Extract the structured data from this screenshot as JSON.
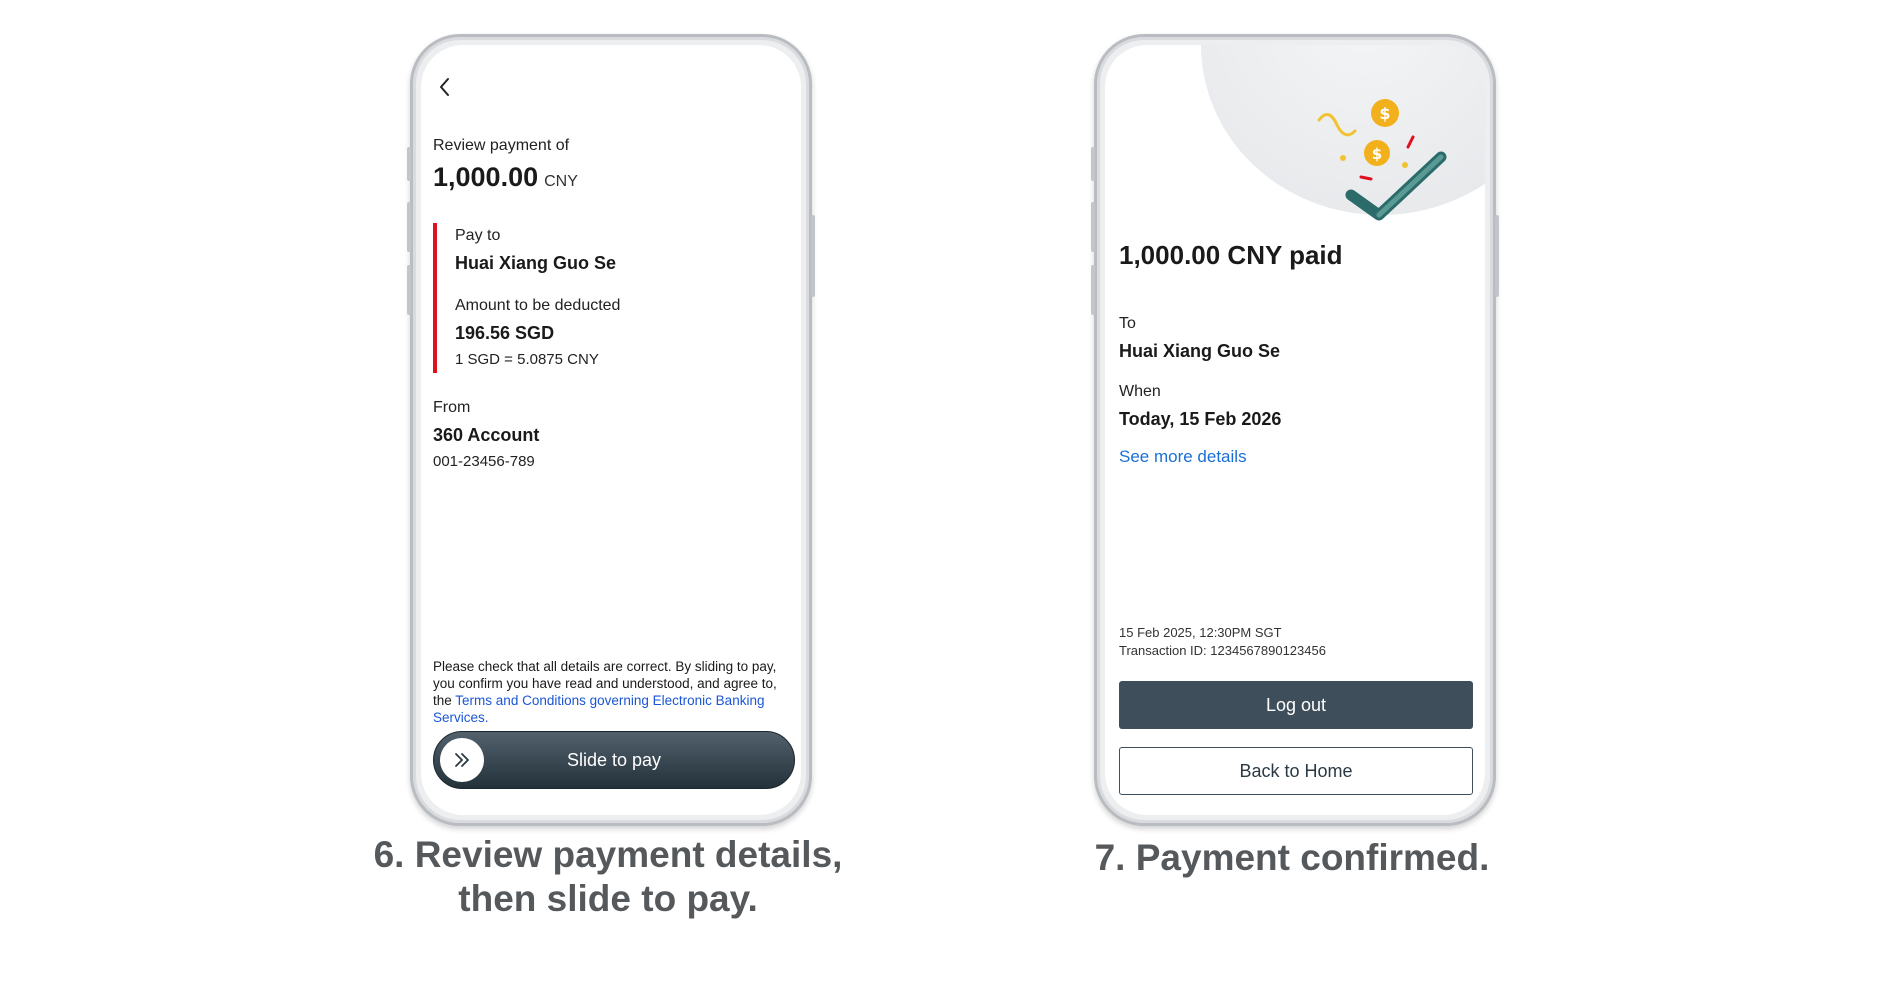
{
  "review_screen": {
    "back_icon": "chevron-left-icon",
    "review_label": "Review payment of",
    "amount": "1,000.00",
    "currency": "CNY",
    "pay_to_label": "Pay to",
    "payee": "Huai Xiang Guo Se",
    "deducted_label": "Amount to be deducted",
    "deducted_amount": "196.56 SGD",
    "rate": "1 SGD =  5.0875 CNY",
    "from_label": "From",
    "account_name": "360 Account",
    "account_number": "001-23456-789",
    "disclaimer_text": "Please check that all details are correct. By sliding to pay, you confirm you have read and understood, and agree to, the",
    "terms_link": "Terms and Conditions governing Electronic Banking Services.",
    "slider_icon": "double-chevron-right-icon",
    "slider_label": "Slide to pay",
    "accent_color": "#e0101d"
  },
  "confirm_screen": {
    "illustration": "coins-checkmark-icon",
    "title": "1,000.00 CNY paid",
    "to_label": "To",
    "payee": "Huai Xiang Guo Se",
    "when_label": "When",
    "when_value": "Today, 15 Feb 2026",
    "details_link": "See more details",
    "timestamp": "15 Feb 2025, 12:30PM SGT",
    "transaction_id": "Transaction ID: 1234567890123456",
    "logout_label": "Log out",
    "home_label": "Back to Home",
    "primary_color": "#3e4f5b",
    "link_color": "#1a6fd6"
  },
  "captions": {
    "step6_line1": "6. Review payment details,",
    "step6_line2": "then slide to pay.",
    "step7": "7. Payment confirmed."
  }
}
